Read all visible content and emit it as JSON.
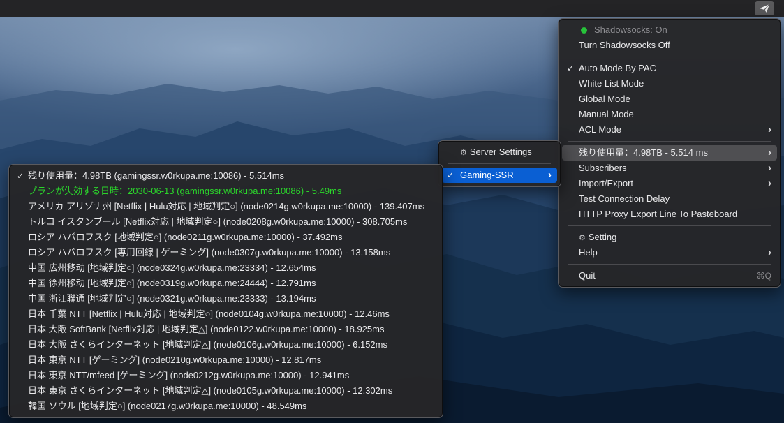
{
  "menubar": {
    "tray_icon": "paper-plane-icon"
  },
  "main_menu": {
    "status": "Shadowsocks: On",
    "toggle": "Turn Shadowsocks Off",
    "modes": [
      {
        "label": "Auto Mode By PAC",
        "checked": true
      },
      {
        "label": "White List Mode",
        "checked": false
      },
      {
        "label": "Global Mode",
        "checked": false
      },
      {
        "label": "Manual Mode",
        "checked": false
      },
      {
        "label": "ACL Mode",
        "checked": false,
        "submenu": true
      }
    ],
    "usage": "残り使用量：4.98TB  - 5.514 ms",
    "subscribers": "Subscribers",
    "import_export": "Import/Export",
    "test_delay": "Test Connection Delay",
    "http_proxy": "HTTP Proxy Export Line To Pasteboard",
    "setting": "Setting",
    "help": "Help",
    "quit": "Quit",
    "quit_shortcut": "⌘Q",
    "check_glyph": "✓",
    "chevron_glyph": "›",
    "gear_glyph": "⚙"
  },
  "sub_menu": {
    "server_settings": "Server Settings",
    "group": "Gaming-SSR",
    "group_checked": true
  },
  "server_list": {
    "items": [
      {
        "label": "残り使用量：4.98TB (gamingssr.w0rkupa.me:10086)  - 5.514ms",
        "checked": true,
        "expired": false
      },
      {
        "label": "プランが失効する日時：2030-06-13 (gamingssr.w0rkupa.me:10086)  - 5.49ms",
        "checked": false,
        "expired": true
      },
      {
        "label": "アメリカ アリゾナ州 [Netflix | Hulu対応 | 地域判定○] (node0214g.w0rkupa.me:10000)  - 139.407ms",
        "checked": false,
        "expired": false
      },
      {
        "label": "トルコ イスタンブール [Netflix対応 | 地域判定○] (node0208g.w0rkupa.me:10000)  - 308.705ms",
        "checked": false,
        "expired": false
      },
      {
        "label": "ロシア ハバロフスク [地域判定○] (node0211g.w0rkupa.me:10000)  - 37.492ms",
        "checked": false,
        "expired": false
      },
      {
        "label": "ロシア ハバロフスク [専用回線 | ゲーミング] (node0307g.w0rkupa.me:10000)  - 13.158ms",
        "checked": false,
        "expired": false
      },
      {
        "label": "中国 広州移动 [地域判定○] (node0324g.w0rkupa.me:23334)  - 12.654ms",
        "checked": false,
        "expired": false
      },
      {
        "label": "中国 徐州移动 [地域判定○] (node0319g.w0rkupa.me:24444)  - 12.791ms",
        "checked": false,
        "expired": false
      },
      {
        "label": "中国 浙江聯通 [地域判定○] (node0321g.w0rkupa.me:23333)  - 13.194ms",
        "checked": false,
        "expired": false
      },
      {
        "label": "日本 千葉 NTT [Netflix | Hulu対応 | 地域判定○] (node0104g.w0rkupa.me:10000)  - 12.46ms",
        "checked": false,
        "expired": false
      },
      {
        "label": "日本 大阪 SoftBank [Netflix対応 | 地域判定△] (node0122.w0rkupa.me:10000)  - 18.925ms",
        "checked": false,
        "expired": false
      },
      {
        "label": "日本 大阪 さくらインターネット [地域判定△] (node0106g.w0rkupa.me:10000)  - 6.152ms",
        "checked": false,
        "expired": false
      },
      {
        "label": "日本 東京 NTT [ゲーミング] (node0210g.w0rkupa.me:10000)  - 12.817ms",
        "checked": false,
        "expired": false
      },
      {
        "label": "日本 東京 NTT/mfeed [ゲーミング] (node0212g.w0rkupa.me:10000)  - 12.941ms",
        "checked": false,
        "expired": false
      },
      {
        "label": "日本 東京 さくらインターネット [地域判定△] (node0105g.w0rkupa.me:10000)  - 12.302ms",
        "checked": false,
        "expired": false
      },
      {
        "label": "韓国 ソウル [地域判定○] (node0217g.w0rkupa.me:10000)  - 48.549ms",
        "checked": false,
        "expired": false
      }
    ]
  },
  "colors": {
    "status_on": "#27c23a",
    "expired_text": "#2bd52b",
    "selection_blue": "#0a5fd3"
  }
}
